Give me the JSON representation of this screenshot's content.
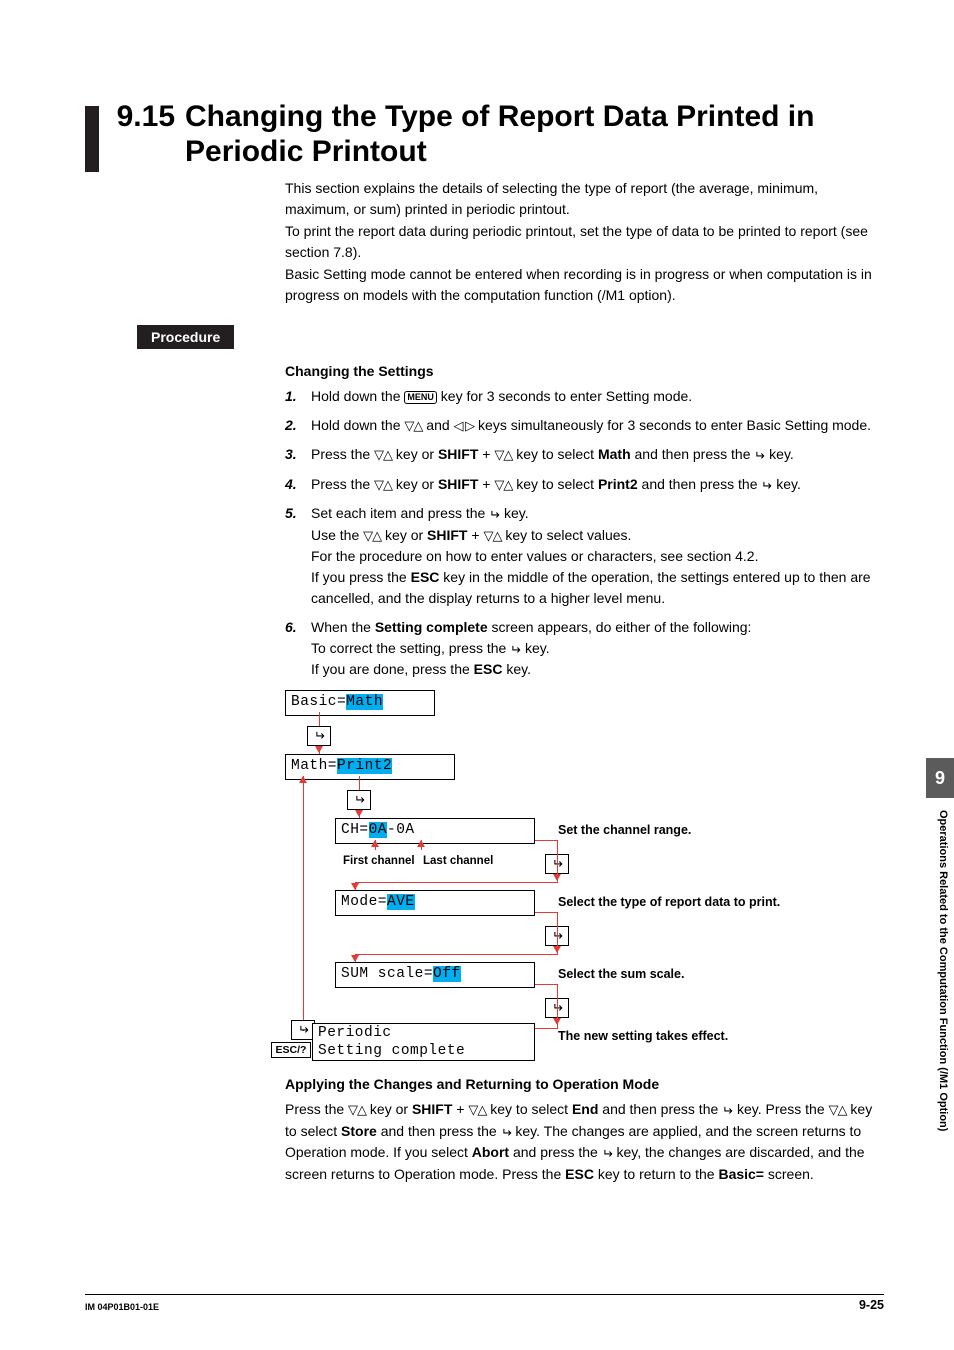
{
  "header": {
    "section_number": "9.15",
    "title": "Changing the Type of Report Data Printed in Periodic Printout"
  },
  "intro": {
    "p1": "This section explains the details of selecting the type of report (the average, minimum, maximum, or sum) printed in periodic printout.",
    "p2": "To print the report data during periodic printout, set the type of data to be printed to report (see section 7.8).",
    "p3": "Basic Setting mode cannot be entered when recording is in progress or when computation is in progress on models with the computation function (/M1 option)."
  },
  "procedure_label": "Procedure",
  "subheading1": "Changing the Settings",
  "steps": {
    "s1a": "Hold down the ",
    "s1b": " key for 3 seconds to enter Setting mode.",
    "s2a": "Hold down the ",
    "s2b": " and ",
    "s2c": " keys simultaneously for 3 seconds to enter Basic Setting mode.",
    "s3a": "Press the ",
    "s3b": " key or ",
    "s3c": " + ",
    "s3d": " key to select ",
    "s3e": " and then press the ",
    "s3f": " key.",
    "s4a": "Press the ",
    "s4b": " key or ",
    "s4c": " + ",
    "s4d": " key to select ",
    "s4e": " and then press the ",
    "s4f": " key.",
    "s5a": "Set each item and press the ",
    "s5b": " key.",
    "s5c": "Use the ",
    "s5d": " key or ",
    "s5e": " + ",
    "s5f": " key to select values.",
    "s5g": "For the procedure on how to enter values or characters, see section 4.2.",
    "s5h": "If you press the ",
    "s5i": " key in the middle of the operation, the settings entered up to then are cancelled, and the display returns to a higher level menu.",
    "s6a": "When the ",
    "s6b": " screen appears, do either of the following:",
    "s6c": "To correct the setting, press the ",
    "s6d": " key.",
    "s6e": "If you are done, press the ",
    "s6f": " key."
  },
  "bold": {
    "shift": "SHIFT",
    "math": "Math",
    "print2": "Print2",
    "esc": "ESC",
    "setting_complete": "Setting complete"
  },
  "menu_key": "MENU",
  "diagram": {
    "box1_pre": "Basic=",
    "box1_hl": "Math",
    "box2_pre": "Math=",
    "box2_hl": "Print2",
    "box3_pre": "CH=",
    "box3_hl": "0A",
    "box3_post": "-0A",
    "box4_pre": "Mode=",
    "box4_hl": "AVE",
    "box5_pre": "SUM scale=",
    "box5_hl": "Off",
    "box6_l1": "Periodic",
    "box6_l2": "Setting complete",
    "lbl_first": "First channel",
    "lbl_last": "Last channel",
    "lbl_ch": "Set the channel range.",
    "lbl_mode": "Select the type of report data to print.",
    "lbl_sum": "Select the sum scale.",
    "lbl_done": "The new setting takes effect.",
    "esc": "ESC/?"
  },
  "subheading2": "Applying the Changes and Returning to Operation Mode",
  "apply": {
    "a": "Press the ",
    "b": " key or ",
    "c": " + ",
    "d": " key to select ",
    "e": " and then press the ",
    "f": " key. Press the ",
    "g": " key to select ",
    "h": " and then press the ",
    "i": " key. The changes are applied, and the screen returns to Operation mode. If you select ",
    "j": " and press the ",
    "k": " key, the changes are discarded, and the screen returns to Operation mode. Press the ",
    "l": " key to return to the ",
    "m": " screen."
  },
  "apply_bold": {
    "end": "End",
    "store": "Store",
    "abort": "Abort",
    "basic": "Basic="
  },
  "footer": {
    "left": "IM 04P01B01-01E",
    "right": "9-25"
  },
  "sidebar": {
    "num": "9",
    "text": "Operations Related to the Computation Function (/M1 Option)"
  }
}
